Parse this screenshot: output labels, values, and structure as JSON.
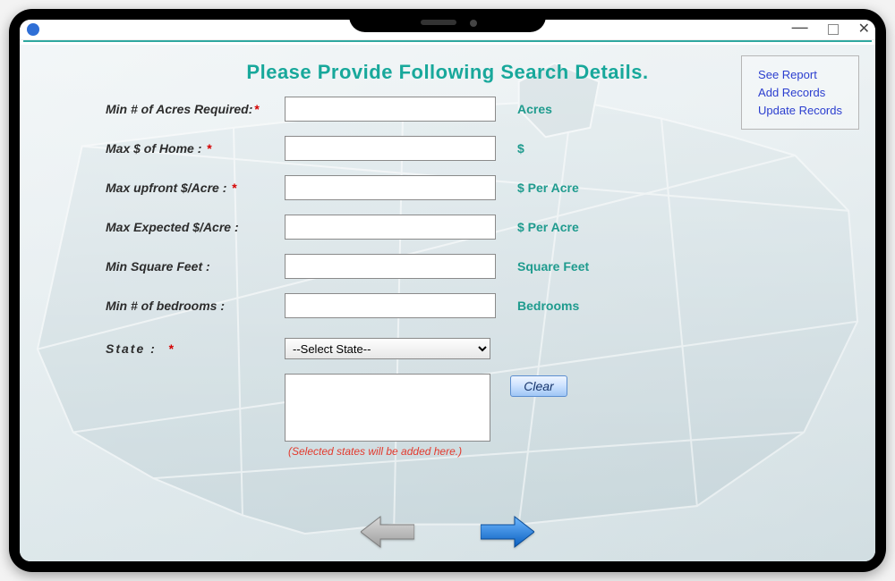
{
  "heading": "Please Provide Following Search Details.",
  "links": {
    "see_report": "See Report",
    "add_records": "Add Records",
    "update_records": "Update Records"
  },
  "fields": {
    "min_acres": {
      "label": "Min # of Acres Required:",
      "required": true,
      "value": "",
      "unit": "Acres"
    },
    "max_home": {
      "label": "Max $ of Home :",
      "required": true,
      "value": "",
      "unit": "$"
    },
    "max_upfront": {
      "label": "Max upfront $/Acre :",
      "required": true,
      "value": "",
      "unit": "$ Per Acre"
    },
    "max_expected": {
      "label": "Max Expected $/Acre :",
      "required": false,
      "value": "",
      "unit": "$ Per Acre"
    },
    "min_sqft": {
      "label": "Min Square Feet :",
      "required": false,
      "value": "",
      "unit": "Square Feet"
    },
    "min_beds": {
      "label": "Min # of bedrooms :",
      "required": false,
      "value": "",
      "unit": "Bedrooms"
    }
  },
  "state": {
    "label": "State   :",
    "required": true,
    "placeholder": "--Select State--",
    "selected_note": "(Selected states will be added here.)"
  },
  "buttons": {
    "clear": "Clear"
  },
  "required_mark": "*"
}
